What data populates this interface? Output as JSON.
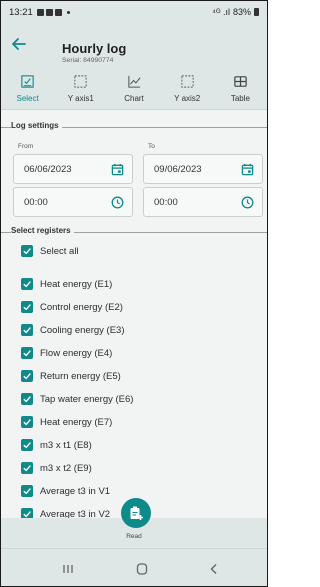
{
  "status_bar": {
    "time": "13:21",
    "signal": "⁴ᴳ .ıl",
    "battery": "83%"
  },
  "header": {
    "title": "Hourly log",
    "subtitle": "Serial: 84990774"
  },
  "tabs": [
    {
      "label": "Select",
      "icon": "select-icon",
      "active": true
    },
    {
      "label": "Y axis1",
      "icon": "y-axis1-icon",
      "active": false
    },
    {
      "label": "Chart",
      "icon": "chart-icon",
      "active": false
    },
    {
      "label": "Y axis2",
      "icon": "y-axis2-icon",
      "active": false
    },
    {
      "label": "Table",
      "icon": "table-icon",
      "active": false
    }
  ],
  "log_settings": {
    "section_title": "Log settings",
    "from_label": "From",
    "to_label": "To",
    "from_date": "06/06/2023",
    "to_date": "09/06/2023",
    "from_time": "00:00",
    "to_time": "00:00"
  },
  "registers": {
    "section_title": "Select registers",
    "select_all_label": "Select all",
    "items": [
      "Heat energy (E1)",
      "Control energy (E2)",
      "Cooling energy (E3)",
      "Flow energy (E4)",
      "Return energy (E5)",
      "Tap water energy (E6)",
      "Heat energy (E7)",
      "m3 x t1 (E8)",
      "m3 x t2 (E9)",
      "Average t3 in V1",
      "Average t3 in V2"
    ]
  },
  "action": {
    "read_label": "Read"
  },
  "colors": {
    "accent": "#0f8a8a",
    "bar_bg": "#dfe6e6",
    "page_bg": "#f2f4f4"
  }
}
